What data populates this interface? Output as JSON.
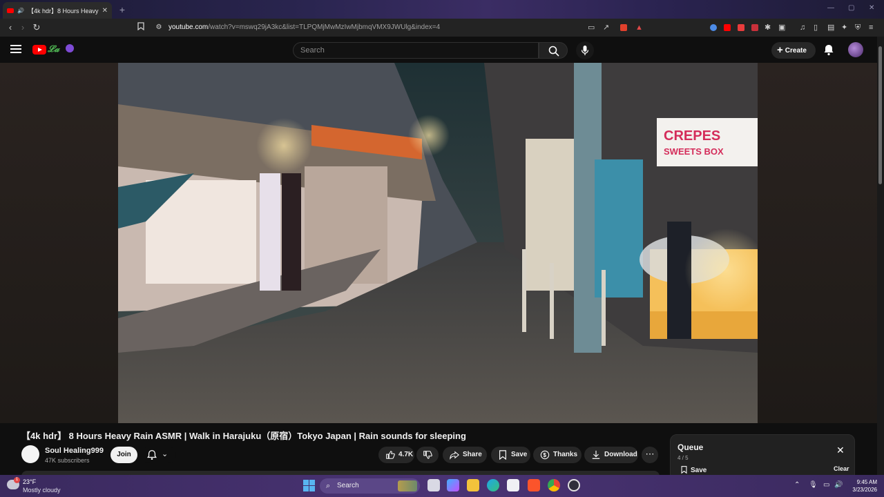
{
  "browser": {
    "tab_title": "【4k hdr】8 Hours Heavy Rain",
    "tab_close": "✕",
    "new_tab": "+",
    "url_host": "youtube.com",
    "url_path": "/watch?v=mswq29jA3kc&list=TLPQMjMwMzIwMjbmqVMX9JWUlg&index=4"
  },
  "youtube": {
    "search_placeholder": "Search",
    "create_label": "Create"
  },
  "video": {
    "title": "【4k hdr】 8 Hours Heavy Rain ASMR | Walk in Harajuku（原宿）Tokyo Japan | Rain sounds for sleeping",
    "scene_sign_line1": "CREPES",
    "scene_sign_line2": "SWEETS BOX"
  },
  "channel": {
    "name": "Soul Healing999",
    "subscribers": "47K subscribers",
    "join_label": "Join"
  },
  "actions": {
    "likes": "4.7K",
    "share": "Share",
    "save": "Save",
    "thanks": "Thanks",
    "download": "Download",
    "more": "⋯"
  },
  "queue": {
    "title": "Queue",
    "count": "4 / 5",
    "save": "Save",
    "clear": "Clear"
  },
  "taskbar": {
    "temperature": "23°F",
    "condition": "Mostly cloudy",
    "weather_badge": "1",
    "search": "Search",
    "time": "9:45 AM",
    "date": "3/23/2026"
  },
  "colors": {
    "brand_red": "#ff0000",
    "bg": "#0f0f0f",
    "pill": "#272727",
    "taskbar": "#4a3374"
  }
}
